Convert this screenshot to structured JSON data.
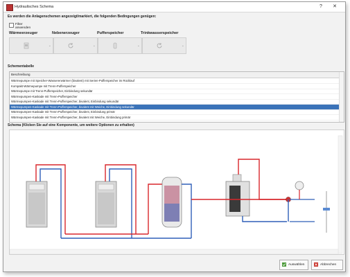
{
  "window": {
    "title": "Hydraulisches Schema"
  },
  "criteria": {
    "heading": "Es werden die Anlagenschemen angezeigt/markiert, die folgenden Bedingungen genügen:",
    "filter_label": "Filter anwenden",
    "categories": [
      {
        "label": "Wärmeerzeuger",
        "icon": "heat-pump-icon"
      },
      {
        "label": "Nebenerzeuger",
        "icon": "refresh-icon"
      },
      {
        "label": "Pufferspeicher",
        "icon": "buffer-tank-icon"
      },
      {
        "label": "Trinkwasserspeicher",
        "icon": "refresh-icon"
      }
    ]
  },
  "table": {
    "heading": "Schementabelle",
    "column": "Beschreibung",
    "rows": [
      "Wärmepumpe mit Speicher-Wassererwärmer (bivalent) mit Serien-Pufferspeicher im Rücklauf",
      "Kompakt-Wärmepumpe mit Trenn-Pufferspeicher",
      "Wärmepumpe mit Trenn-Pufferspeicher, Einbindung sekundär",
      "Wärmepumpen-Kaskade mit Trenn-Pufferspeicher",
      "Wärmepumpen-Kaskade mit Trenn-Pufferspeicher, bivalent, Einbindung sekundär",
      "Wärmepumpen-Kaskade mit Trenn-Pufferspeicher, bivalent mit Weiche, Einbindung sekundär",
      "Wärmepumpen-Kaskade mit Trenn-Pufferspeicher, bivalent, Einbindung primär",
      "Wärmepumpen-Kaskade mit Trenn-Pufferspeicher, bivalent mit Weiche, Einbindung primär"
    ],
    "selected_index": 5
  },
  "schema": {
    "heading": "Schema (Klicken Sie auf eine Komponente, um weitere Optionen zu erhalten)"
  },
  "buttons": {
    "select": "Auswählen",
    "cancel": "Abbrechen"
  },
  "colors": {
    "selection": "#3b73b9",
    "flow": "#d8262b",
    "return": "#2f5fb8"
  }
}
